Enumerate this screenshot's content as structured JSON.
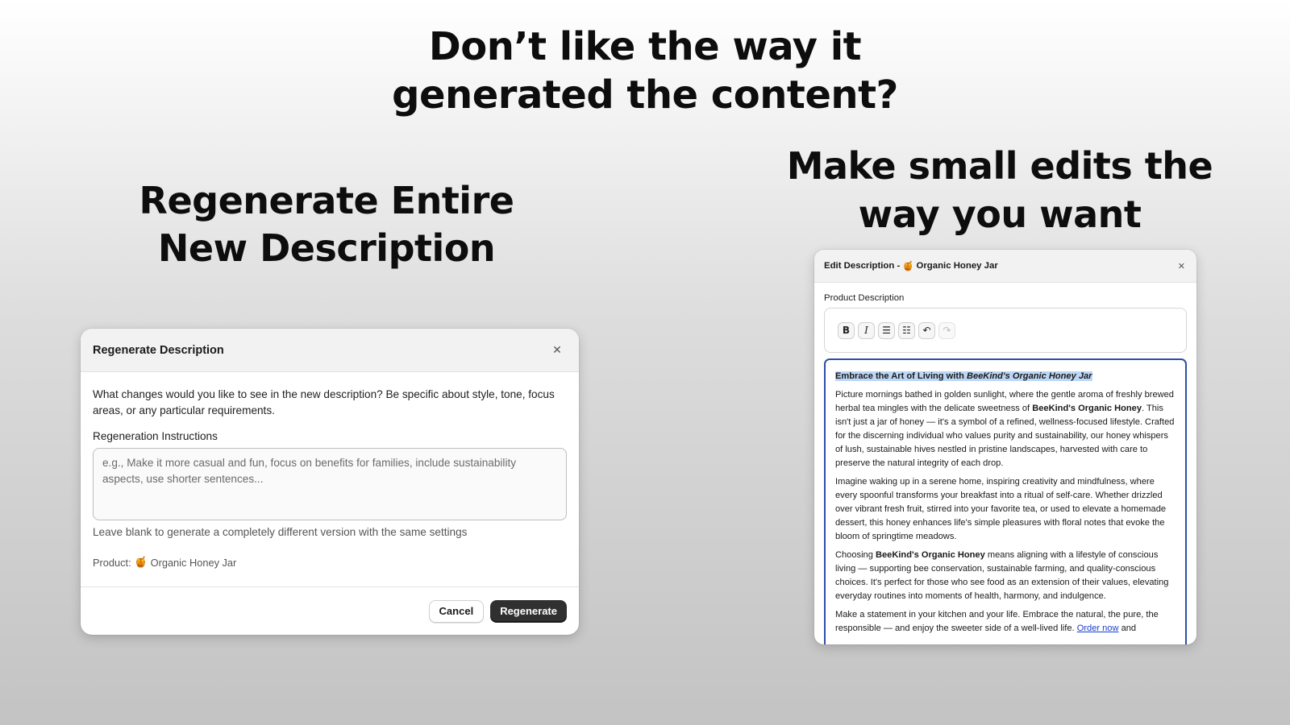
{
  "headlines": {
    "top_line1": "Don’t like the way it",
    "top_line2": "generated the content?",
    "left_line1": "Regenerate Entire",
    "left_line2": "New Description",
    "right_line1": "Make small edits the",
    "right_line2": "way you want"
  },
  "regen_modal": {
    "title": "Regenerate Description",
    "close_glyph": "✕",
    "description": "What changes would you like to see in the new description? Be specific about style, tone, focus areas, or any particular requirements.",
    "instructions_label": "Regeneration Instructions",
    "instructions_placeholder": "e.g., Make it more casual and fun, focus on benefits for families, include sustainability aspects, use shorter sentences...",
    "instructions_value": "",
    "help_text": "Leave blank to generate a completely different version with the same settings",
    "product_prefix": "Product:",
    "product_emoji": "🍯",
    "product_name": "Organic Honey Jar",
    "cancel_label": "Cancel",
    "regenerate_label": "Regenerate"
  },
  "edit_modal": {
    "title_prefix": "Edit Description -",
    "product_emoji": "🍯",
    "product_name": "Organic Honey Jar",
    "close_glyph": "✕",
    "field_label": "Product Description",
    "toolbar": {
      "bold": "B",
      "italic": "I",
      "bullet_list": "☰",
      "numbered_list": "☷",
      "undo": "↶",
      "redo": "↷"
    },
    "content": {
      "heading_plain": "Embrace the Art of Living with",
      "heading_italic": "BeeKind's Organic Honey Jar",
      "p1_a": "Picture mornings bathed in golden sunlight, where the gentle aroma of freshly brewed herbal tea mingles with the delicate sweetness of",
      "p1_bold": "BeeKind's Organic Honey",
      "p1_b": ". This isn't just a jar of honey — it's a symbol of a refined, wellness-focused lifestyle. Crafted for the discerning individual who values purity and sustainability, our honey whispers of lush, sustainable hives nestled in pristine landscapes, harvested with care to preserve the natural integrity of each drop.",
      "p2": "Imagine waking up in a serene home, inspiring creativity and mindfulness, where every spoonful transforms your breakfast into a ritual of self-care. Whether drizzled over vibrant fresh fruit, stirred into your favorite tea, or used to elevate a homemade dessert, this honey enhances life's simple pleasures with floral notes that evoke the bloom of springtime meadows.",
      "p3_a": "Choosing",
      "p3_bold": "BeeKind's Organic Honey",
      "p3_b": "means aligning with a lifestyle of conscious living — supporting bee conservation, sustainable farming, and quality-conscious choices. It's perfect for those who see food as an extension of their values, elevating everyday routines into moments of health, harmony, and indulgence.",
      "p4_a": "Make a statement in your kitchen and your life. Embrace the natural, the pure, the responsible — and enjoy the sweeter side of a well-lived life.",
      "p4_link": "Order now",
      "p4_b": "and"
    }
  },
  "colors": {
    "primary_button": "#303030",
    "editor_focus_border": "#2c4fa6",
    "selection_highlight": "#bcd6f5",
    "link": "#1a3ecf"
  }
}
